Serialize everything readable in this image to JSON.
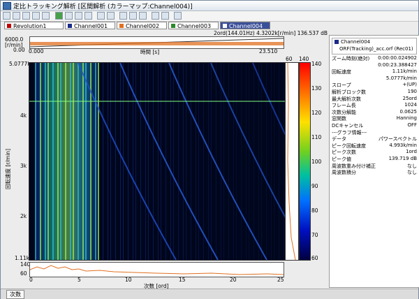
{
  "window": {
    "title": "定比トラッキング解析 [区間解析 (カラーマップ:Channel004)]"
  },
  "tabs": [
    {
      "label": "Revolution1",
      "color": "#c00000"
    },
    {
      "label": "Channel001",
      "color": "#1a2a8a"
    },
    {
      "label": "Channel002",
      "color": "#e07020"
    },
    {
      "label": "Channel003",
      "color": "#2a8a2a"
    },
    {
      "label": "Channel004",
      "color": "#1a2a8a"
    }
  ],
  "cursor_readout": "2ord(144.01Hz) 4.3202k[r/min] 136.537 dB",
  "rpm_plot": {
    "y_top": "6000.0",
    "y_unit": "[r/min]",
    "y_bottom": "0.00",
    "x_left": "0.000",
    "x_right": "23.510",
    "x_label": "時間 [s]"
  },
  "colormap": {
    "y_label": "回転速度 [r/min]",
    "y_ticks": [
      "5.0777k",
      "4k",
      "3k",
      "2k",
      "1.11k"
    ],
    "x_label": "次数 [ord]",
    "x_ticks": [
      "0",
      "5",
      "10",
      "15",
      "20",
      "25"
    ],
    "side_top_left": "60",
    "side_top_right": "140"
  },
  "colorbar_ticks": [
    "140",
    "130",
    "120",
    "110",
    "100",
    "90",
    "80",
    "70",
    "60"
  ],
  "order_plot": {
    "y_top": "140",
    "y_bottom": "60"
  },
  "info_panel": {
    "channel": "Channel004",
    "file": "ORF(Tracking)_acc.orf (Rec01)",
    "rows": [
      {
        "k": "ズーム時刻(絶対)",
        "v": "0:00:00.024902"
      },
      {
        "k": "",
        "v": "0:00:23.388427"
      },
      {
        "k": "回転速度",
        "v": "1.11k/min"
      },
      {
        "k": "",
        "v": "5.0777k/min"
      },
      {
        "k": "スロープ",
        "v": "+(UP)"
      },
      {
        "k": "解析ブロック数",
        "v": "190"
      },
      {
        "k": "最大解析次数",
        "v": "25ord"
      },
      {
        "k": "フレーム長",
        "v": "1024"
      },
      {
        "k": "次数分解能",
        "v": "0.0625"
      },
      {
        "k": "窓関数",
        "v": "Hanning"
      },
      {
        "k": "DCキャンセル",
        "v": "OFF"
      },
      {
        "k": "---グラフ情報---",
        "v": ""
      },
      {
        "k": "データ",
        "v": "パワースペクトル"
      },
      {
        "k": "ピーク回転速度",
        "v": "4.993k/min"
      },
      {
        "k": "ピーク次数",
        "v": "1ord"
      },
      {
        "k": "ピーク値",
        "v": "139.719 dB"
      },
      {
        "k": "周波数重み付け補正",
        "v": "なし"
      },
      {
        "k": "周波数積分",
        "v": "なし"
      }
    ]
  },
  "status_tab": "次数"
}
